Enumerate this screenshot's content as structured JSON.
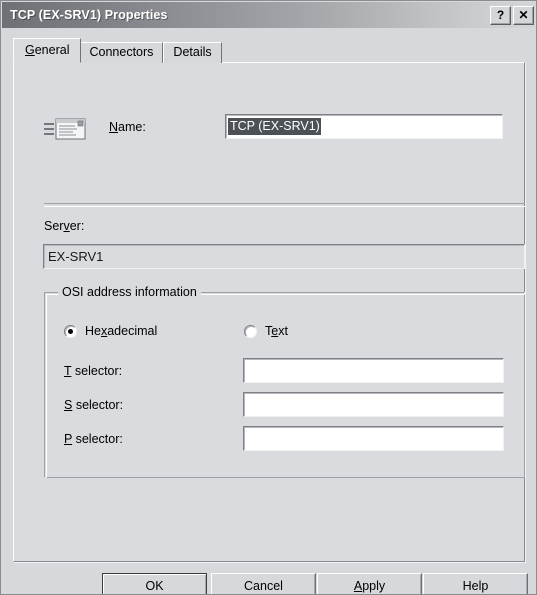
{
  "window": {
    "title": "TCP (EX-SRV1) Properties",
    "help_button": "?",
    "close_button": "✕"
  },
  "tabs": [
    {
      "label": "General",
      "accel": "G",
      "active": true,
      "name": "tab-general"
    },
    {
      "label": "Connectors",
      "accel": "C",
      "active": false,
      "name": "tab-connectors"
    },
    {
      "label": "Details",
      "accel": "D",
      "active": false,
      "name": "tab-details"
    }
  ],
  "general": {
    "icon": "connector-icon",
    "name_label_pre": "N",
    "name_label_post": "ame:",
    "name_value": "TCP (EX-SRV1)",
    "server_label_pre": "Ser",
    "server_label_accel": "v",
    "server_label_post": "er:",
    "server_value": "EX-SRV1",
    "group": {
      "legend": "OSI address information",
      "radios": [
        {
          "pre": "He",
          "accel": "x",
          "post": "adecimal",
          "checked": true,
          "name": "radio-hexadecimal"
        },
        {
          "pre": "T",
          "accel": "e",
          "post": "xt",
          "checked": false,
          "name": "radio-text"
        }
      ],
      "selectors": [
        {
          "accel": "T",
          "post": " selector:",
          "value": "",
          "name": "t-selector"
        },
        {
          "accel": "S",
          "post": " selector:",
          "value": "",
          "name": "s-selector"
        },
        {
          "accel": "P",
          "post": " selector:",
          "value": "",
          "name": "p-selector"
        }
      ]
    }
  },
  "buttons": [
    {
      "label": "OK",
      "accel": "",
      "default": true,
      "name": "ok-button"
    },
    {
      "label": "Cancel",
      "accel": "",
      "default": false,
      "name": "cancel-button"
    },
    {
      "label": "Apply",
      "accel": "A",
      "default": false,
      "name": "apply-button"
    },
    {
      "label": "Help",
      "accel": "",
      "default": false,
      "name": "help-button"
    }
  ],
  "colors": {
    "dialog_face": "#d6d8dc",
    "panel_face": "#d9dbdf",
    "title_dark": "#6e7076",
    "title_light": "#d4d6da",
    "selection": "#4c5156",
    "field_white": "#ffffff"
  }
}
